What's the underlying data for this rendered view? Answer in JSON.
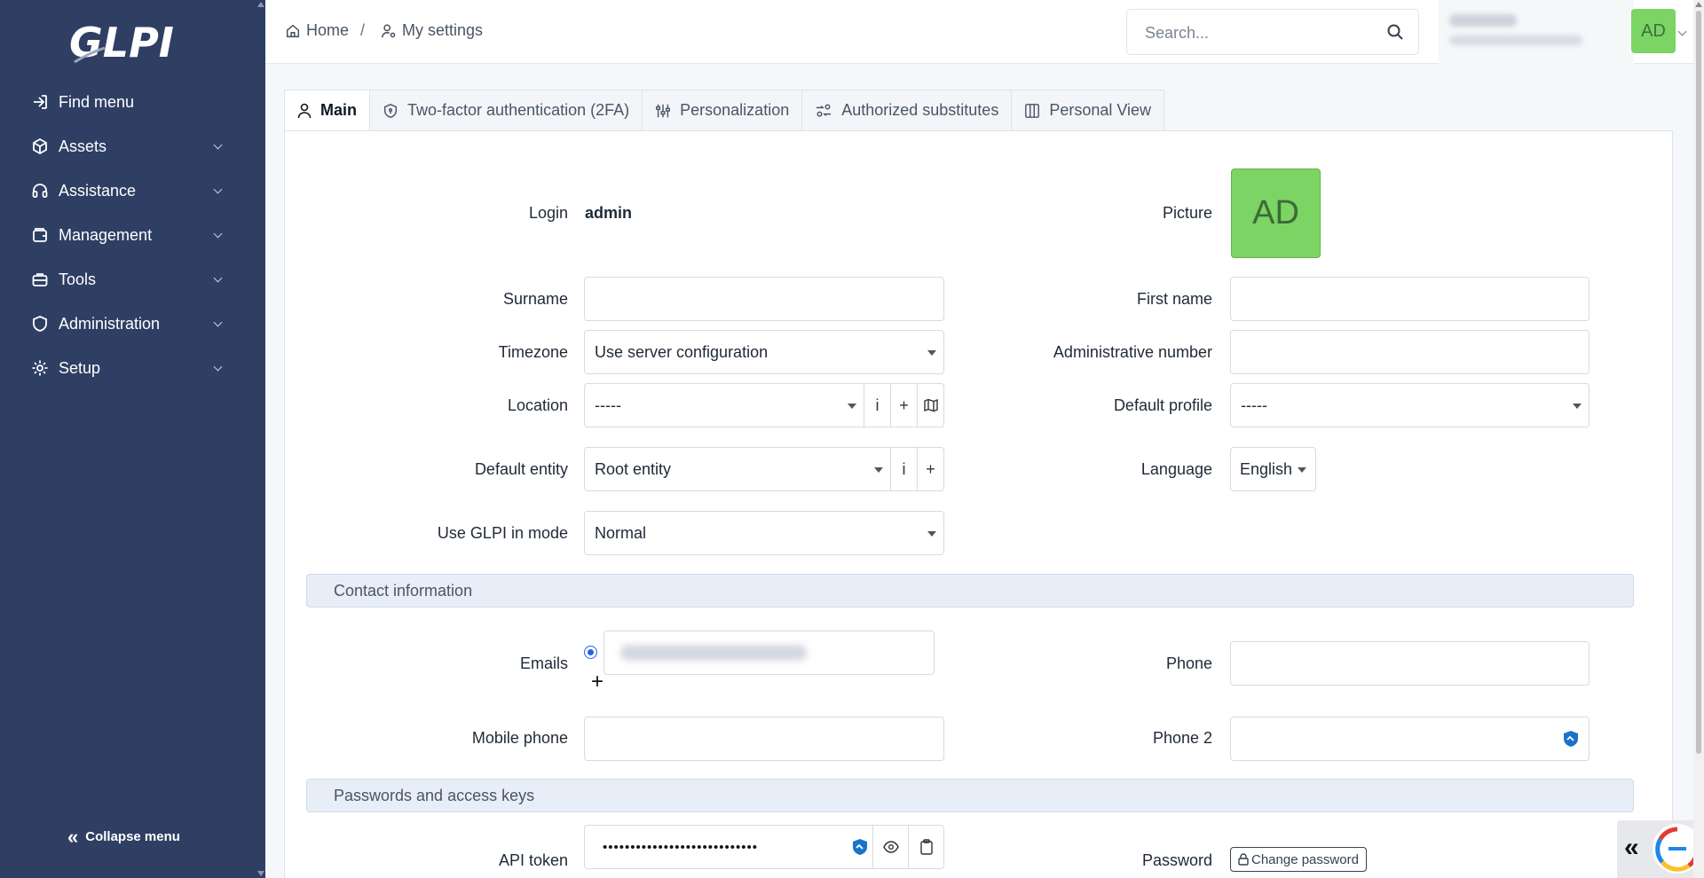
{
  "app": {
    "logo_text": "GLPI"
  },
  "sidebar": {
    "items": [
      {
        "label": "Find menu",
        "icon": "arrow-right-to-bracket-icon",
        "has_children": false
      },
      {
        "label": "Assets",
        "icon": "cube-icon",
        "has_children": true
      },
      {
        "label": "Assistance",
        "icon": "headset-icon",
        "has_children": true
      },
      {
        "label": "Management",
        "icon": "wallet-icon",
        "has_children": true
      },
      {
        "label": "Tools",
        "icon": "briefcase-icon",
        "has_children": true
      },
      {
        "label": "Administration",
        "icon": "shield-icon",
        "has_children": true
      },
      {
        "label": "Setup",
        "icon": "gear-icon",
        "has_children": true
      }
    ],
    "collapse_label": "Collapse menu"
  },
  "header": {
    "breadcrumbs": [
      {
        "label": "Home",
        "icon": "home-icon"
      },
      {
        "label": "My settings",
        "icon": "user-settings-icon"
      }
    ],
    "separator": "/",
    "search_placeholder": "Search...",
    "user_initials": "AD"
  },
  "tabs": [
    {
      "label": "Main",
      "icon": "user-icon",
      "active": true
    },
    {
      "label": "Two-factor authentication (2FA)",
      "icon": "shield-check-icon",
      "active": false
    },
    {
      "label": "Personalization",
      "icon": "sliders-icon",
      "active": false
    },
    {
      "label": "Authorized substitutes",
      "icon": "user-switch-icon",
      "active": false
    },
    {
      "label": "Personal View",
      "icon": "columns-icon",
      "active": false
    }
  ],
  "form": {
    "login_label": "Login",
    "login_value": "admin",
    "picture_label": "Picture",
    "picture_initials": "AD",
    "surname_label": "Surname",
    "surname_value": "",
    "firstname_label": "First name",
    "firstname_value": "",
    "timezone_label": "Timezone",
    "timezone_value": "Use server configuration",
    "admin_number_label": "Administrative number",
    "admin_number_value": "",
    "location_label": "Location",
    "location_value": "-----",
    "default_profile_label": "Default profile",
    "default_profile_value": "-----",
    "default_entity_label": "Default entity",
    "default_entity_value": "Root entity",
    "language_label": "Language",
    "language_value": "English",
    "mode_label": "Use GLPI in mode",
    "mode_value": "Normal",
    "info_glyph": "i",
    "plus_glyph": "+"
  },
  "contact": {
    "section_title": "Contact information",
    "emails_label": "Emails",
    "phone_label": "Phone",
    "phone_value": "",
    "mobile_label": "Mobile phone",
    "mobile_value": "",
    "phone2_label": "Phone 2",
    "phone2_value": ""
  },
  "passwords": {
    "section_title": "Passwords and access keys",
    "api_token_label": "API token",
    "api_token_value": "••••••••••••••••••••••••••••",
    "password_label": "Password",
    "change_password_label": "Change password"
  },
  "colors": {
    "sidebar_bg": "#2f3f64",
    "avatar_bg": "#7bd463",
    "section_bg": "#e7eef7",
    "radio_accent": "#2563eb"
  }
}
